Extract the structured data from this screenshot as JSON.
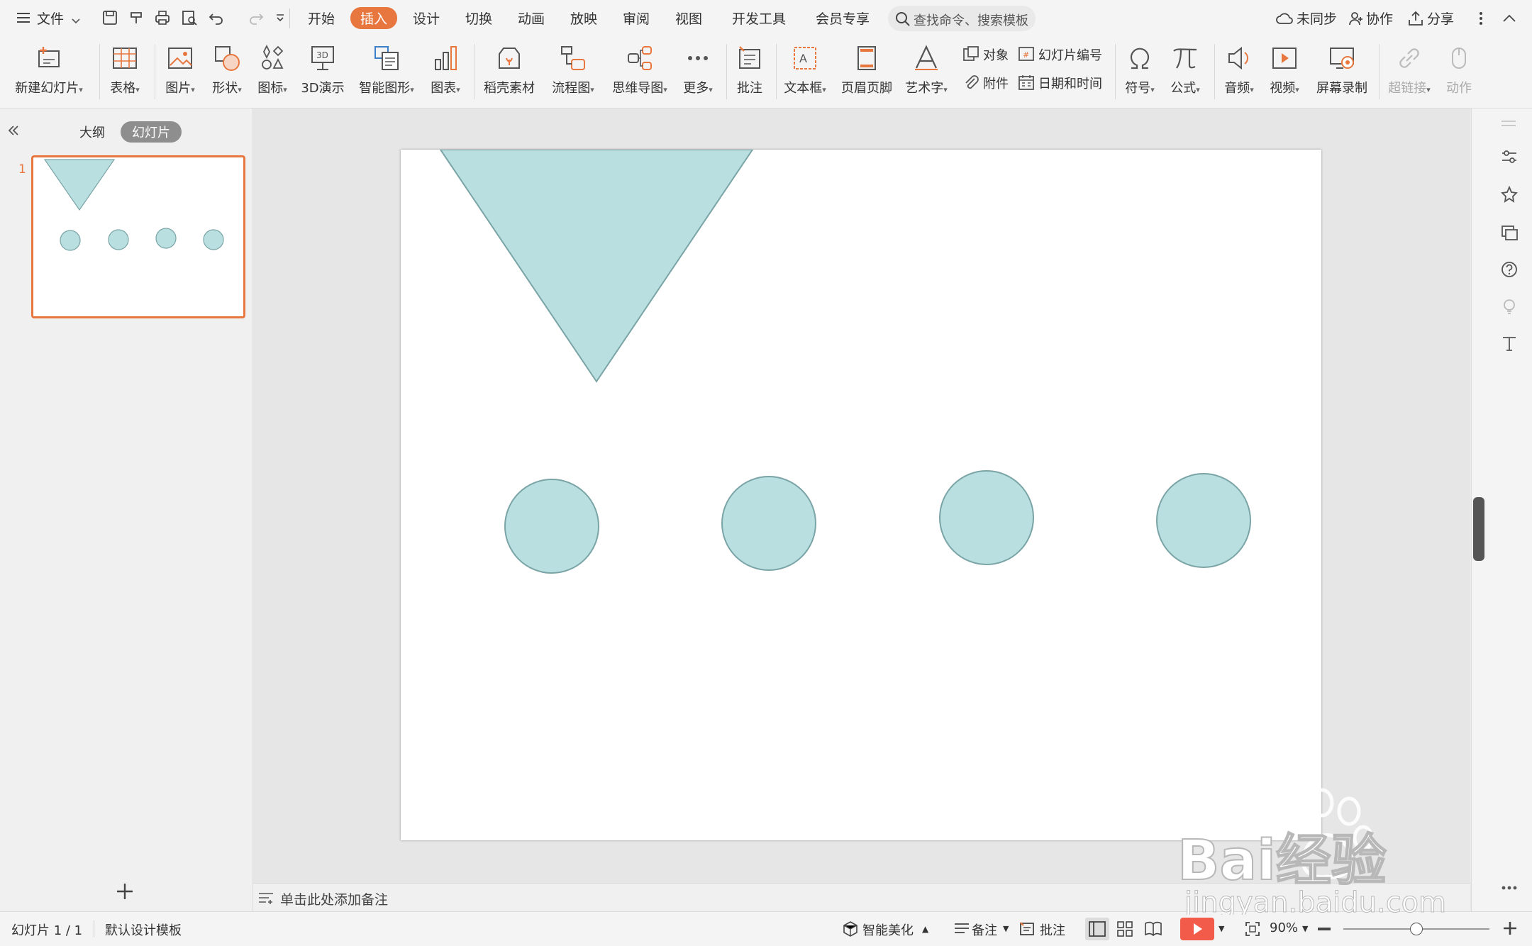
{
  "menu": {
    "file_label": "文件",
    "tabs": [
      "开始",
      "插入",
      "设计",
      "切换",
      "动画",
      "放映",
      "审阅",
      "视图",
      "开发工具",
      "会员专享"
    ],
    "active_tab": "插入",
    "search_placeholder": "查找命令、搜索模板",
    "right": {
      "sync": "未同步",
      "collab": "协作",
      "share": "分享"
    }
  },
  "ribbon": {
    "new_slide": "新建幻灯片",
    "table": "表格",
    "picture": "图片",
    "shape": "形状",
    "icon": "图标",
    "demo3d": "3D演示",
    "smartart": "智能图形",
    "chart": "图表",
    "daoke": "稻壳素材",
    "flowchart": "流程图",
    "mindmap": "思维导图",
    "more": "更多",
    "comment": "批注",
    "textbox": "文本框",
    "header_footer": "页眉页脚",
    "wordart": "艺术字",
    "object": "对象",
    "slide_number": "幻灯片编号",
    "attachment": "附件",
    "datetime": "日期和时间",
    "symbol": "符号",
    "formula": "公式",
    "audio": "音频",
    "video": "视频",
    "screen_record": "屏幕录制",
    "hyperlink": "超链接",
    "action": "动作"
  },
  "leftpane": {
    "tab_outline": "大纲",
    "tab_slides": "幻灯片",
    "slide_number": "1"
  },
  "notes": {
    "placeholder": "单击此处添加备注"
  },
  "status": {
    "slide_count": "幻灯片 1 / 1",
    "template": "默认设计模板",
    "beautify": "智能美化",
    "notes": "备注",
    "comments": "批注",
    "zoom": "90%",
    "zoom_level": 0.5
  },
  "colors": {
    "accent": "#e8763f",
    "shape_fill": "#b9dfe1",
    "shape_stroke": "#7aa4a6"
  },
  "watermark": {
    "brand": "Bai经验",
    "site": "jingyan.baidu.com"
  }
}
